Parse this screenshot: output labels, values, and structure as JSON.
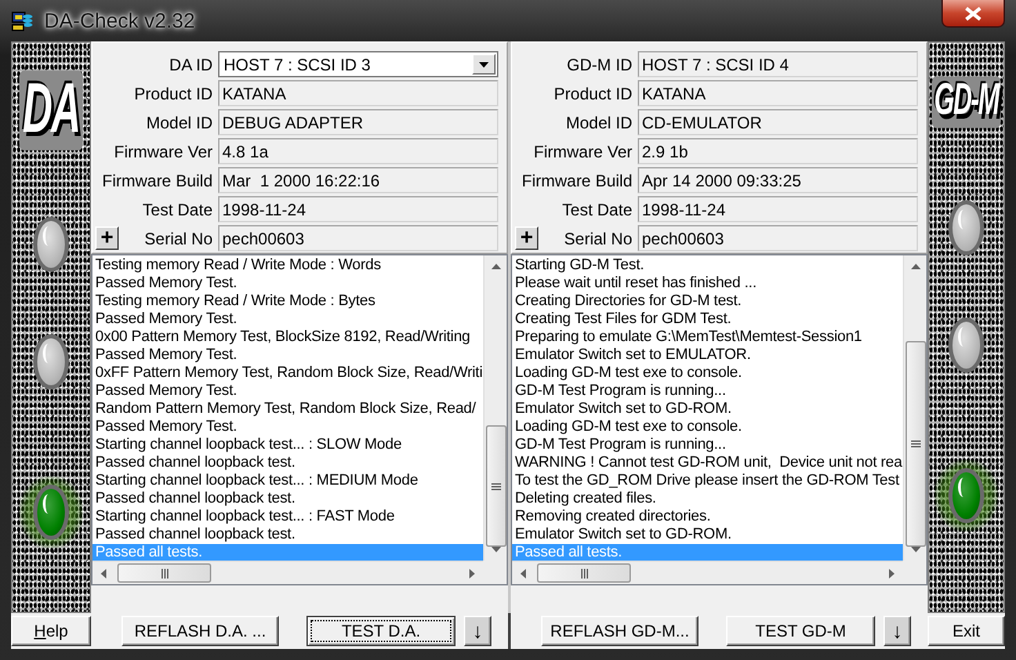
{
  "window": {
    "title": "DA-Check v2.32"
  },
  "side_panels": [
    {
      "label": "DA",
      "lights": [
        {
          "on": false
        },
        {
          "on": false
        },
        {
          "on": true
        }
      ]
    },
    {
      "label": "GD-M",
      "lights": [
        {
          "on": false
        },
        {
          "on": false
        },
        {
          "on": true
        }
      ]
    }
  ],
  "devices": [
    {
      "fields": [
        {
          "label": "DA ID",
          "value": "HOST 7 : SCSI ID 3",
          "kind": "dropdown"
        },
        {
          "label": "Product ID",
          "value": "KATANA",
          "kind": "field"
        },
        {
          "label": "Model ID",
          "value": "DEBUG ADAPTER",
          "kind": "field"
        },
        {
          "label": "Firmware Ver",
          "value": "4.8 1a",
          "kind": "field"
        },
        {
          "label": "Firmware Build",
          "value": "Mar  1 2000 16:22:16",
          "kind": "field"
        },
        {
          "label": "Test Date",
          "value": "1998-11-24",
          "kind": "field"
        },
        {
          "label": "Serial No",
          "value": "pech00603",
          "kind": "field"
        }
      ],
      "expand_button": "+",
      "log": [
        {
          "text": "Testing memory Read / Write Mode : Words",
          "selected": false
        },
        {
          "text": "Passed Memory Test.",
          "selected": false
        },
        {
          "text": "Testing memory Read / Write Mode : Bytes",
          "selected": false
        },
        {
          "text": "Passed Memory Test.",
          "selected": false
        },
        {
          "text": "0x00 Pattern Memory Test, BlockSize 8192, Read/Writing",
          "selected": false
        },
        {
          "text": "Passed Memory Test.",
          "selected": false
        },
        {
          "text": "0xFF Pattern Memory Test, Random Block Size, Read/Writi",
          "selected": false
        },
        {
          "text": "Passed Memory Test.",
          "selected": false
        },
        {
          "text": "Random Pattern Memory Test, Random Block Size, Read/",
          "selected": false
        },
        {
          "text": "Passed Memory Test.",
          "selected": false
        },
        {
          "text": "Starting channel loopback test... : SLOW Mode",
          "selected": false
        },
        {
          "text": "Passed channel loopback test.",
          "selected": false
        },
        {
          "text": "Starting channel loopback test... : MEDIUM Mode",
          "selected": false
        },
        {
          "text": "Passed channel loopback test.",
          "selected": false
        },
        {
          "text": "Starting channel loopback test... : FAST Mode",
          "selected": false
        },
        {
          "text": "Passed channel loopback test.",
          "selected": false
        },
        {
          "text": "Passed all tests.",
          "selected": true
        }
      ],
      "buttons": [
        {
          "label": "REFLASH D.A. ...",
          "kind": "text",
          "focused": false
        },
        {
          "label": "TEST D.A.",
          "kind": "text",
          "focused": true
        },
        {
          "label": "↓",
          "kind": "arrow",
          "focused": false
        }
      ]
    },
    {
      "fields": [
        {
          "label": "GD-M ID",
          "value": "HOST 7 : SCSI ID 4",
          "kind": "field"
        },
        {
          "label": "Product ID",
          "value": "KATANA",
          "kind": "field"
        },
        {
          "label": "Model ID",
          "value": "CD-EMULATOR",
          "kind": "field"
        },
        {
          "label": "Firmware Ver",
          "value": "2.9 1b",
          "kind": "field"
        },
        {
          "label": "Firmware Build",
          "value": "Apr 14 2000 09:33:25",
          "kind": "field"
        },
        {
          "label": "Test Date",
          "value": "1998-11-24",
          "kind": "field"
        },
        {
          "label": "Serial No",
          "value": "pech00603",
          "kind": "field"
        }
      ],
      "expand_button": "+",
      "log": [
        {
          "text": "Starting GD-M Test.",
          "selected": false
        },
        {
          "text": "Please wait until reset has finished ...",
          "selected": false
        },
        {
          "text": "Creating Directories for GD-M test.",
          "selected": false
        },
        {
          "text": "Creating Test Files for GDM Test.",
          "selected": false
        },
        {
          "text": "Preparing to emulate G:\\MemTest\\Memtest-Session1",
          "selected": false
        },
        {
          "text": "Emulator Switch set to EMULATOR.",
          "selected": false
        },
        {
          "text": "Loading GD-M test exe to console.",
          "selected": false
        },
        {
          "text": "GD-M Test Program is running...",
          "selected": false
        },
        {
          "text": "Emulator Switch set to GD-ROM.",
          "selected": false
        },
        {
          "text": "Loading GD-M test exe to console.",
          "selected": false
        },
        {
          "text": "GD-M Test Program is running...",
          "selected": false
        },
        {
          "text": "WARNING ! Cannot test GD-ROM unit,  Device unit not rea",
          "selected": false
        },
        {
          "text": "To test the GD_ROM Drive please insert the GD-ROM Test",
          "selected": false
        },
        {
          "text": "Deleting created files.",
          "selected": false
        },
        {
          "text": "Removing created directories.",
          "selected": false
        },
        {
          "text": "Emulator Switch set to GD-ROM.",
          "selected": false
        },
        {
          "text": "Passed all tests.",
          "selected": true
        }
      ],
      "buttons": [
        {
          "label": "REFLASH GD-M...",
          "kind": "text",
          "focused": false
        },
        {
          "label": "TEST GD-M",
          "kind": "text",
          "focused": false
        },
        {
          "label": "↓",
          "kind": "arrow",
          "focused": false
        }
      ]
    }
  ],
  "help_button": {
    "label": "Help",
    "underline_first": true
  },
  "exit_button": {
    "label": "Exit",
    "underline_first": false
  }
}
